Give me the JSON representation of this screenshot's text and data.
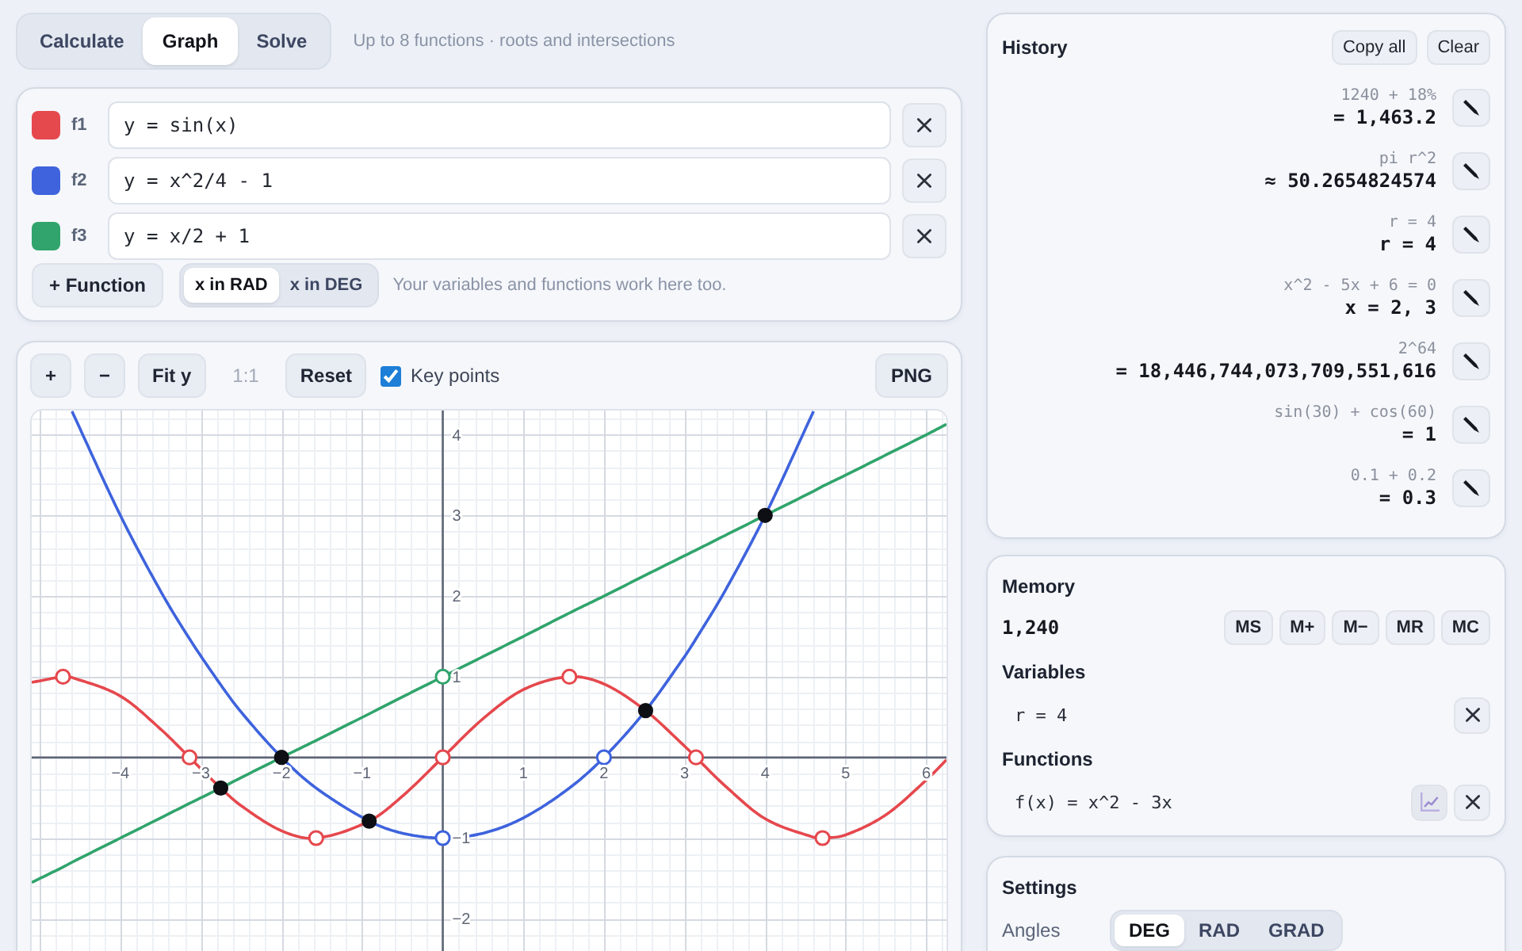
{
  "mode_tabs": [
    {
      "label": "Calculate",
      "selected": false
    },
    {
      "label": "Graph",
      "selected": true
    },
    {
      "label": "Solve",
      "selected": false
    }
  ],
  "mode_hint": "Up to 8 functions · roots and intersections",
  "functions": [
    {
      "label": "f1",
      "color": "#e5484d",
      "expression": "y = sin(x)"
    },
    {
      "label": "f2",
      "color": "#3e63dd",
      "expression": "y = x^2/4 - 1"
    },
    {
      "label": "f3",
      "color": "#30a46c",
      "expression": "y = x/2 + 1"
    }
  ],
  "function_bar": {
    "add_button": "+ Function",
    "x_units": [
      {
        "label": "x in RAD",
        "selected": true
      },
      {
        "label": "x in DEG",
        "selected": false
      }
    ],
    "hint": "Your variables and functions work here too."
  },
  "graph": {
    "toolbar": [
      {
        "label": "+",
        "disabled": false
      },
      {
        "label": "−",
        "disabled": false
      },
      {
        "label": "Fit y",
        "disabled": false
      },
      {
        "label": "1:1",
        "disabled": true
      },
      {
        "label": "Reset",
        "disabled": false
      }
    ],
    "key_points": {
      "label": "Key points",
      "checked": true
    },
    "export_button": "PNG",
    "chart_data": {
      "type": "line",
      "grid": true,
      "x": [
        -5.1,
        -4.712,
        -4.6,
        -4,
        -3.5,
        -3.142,
        -2.755,
        -2.5,
        -2,
        -1.571,
        -0.913,
        -0.5,
        0,
        0.5,
        1,
        1.571,
        2,
        2.517,
        3,
        3.142,
        3.5,
        4,
        4.6,
        4.712,
        5,
        5.5,
        6,
        6.25
      ],
      "series": [
        {
          "color": "#e5484d",
          "values": [
            0.93,
            1,
            0.99,
            0.76,
            0.35,
            0,
            -0.38,
            -0.6,
            -0.91,
            -1,
            -0.79,
            -0.48,
            0,
            0.48,
            0.84,
            1,
            0.91,
            0.58,
            0.14,
            0,
            -0.35,
            -0.76,
            -0.99,
            -1,
            -0.96,
            -0.71,
            -0.28,
            -0.03
          ]
        },
        {
          "color": "#3e63dd",
          "values": [
            null,
            null,
            4.29,
            3,
            2.06,
            1.47,
            0.9,
            0.56,
            0,
            -0.38,
            -0.79,
            -0.94,
            -1,
            -0.94,
            -0.75,
            -0.38,
            0,
            0.58,
            1.25,
            1.47,
            2.06,
            3,
            4.29,
            null,
            null,
            null,
            null,
            null
          ]
        },
        {
          "color": "#30a46c",
          "values": [
            -1.55,
            -1.36,
            -1.3,
            -1,
            -0.75,
            -0.57,
            -0.38,
            -0.25,
            0,
            0.21,
            0.54,
            0.75,
            1,
            1.25,
            1.5,
            1.79,
            2,
            2.26,
            2.5,
            2.57,
            2.75,
            3,
            3.3,
            3.36,
            3.5,
            3.75,
            4,
            4.13
          ]
        }
      ],
      "xlim": [
        -5.1,
        6.25
      ],
      "ylim": [
        -2.4,
        4.3
      ],
      "xticks": [
        {
          "value": -4,
          "label": "−4"
        },
        {
          "value": -3,
          "label": "−3"
        },
        {
          "value": -2,
          "label": "−2"
        },
        {
          "value": -1,
          "label": "−1"
        },
        1,
        2,
        3,
        4,
        5,
        6
      ],
      "yticks": [
        {
          "value": -2,
          "label": "−2"
        },
        {
          "value": -1,
          "label": "−1"
        },
        1,
        2,
        3,
        4
      ]
    }
  },
  "history": {
    "title": "History",
    "buttons": [
      "Copy all",
      "Clear"
    ],
    "entries": [
      {
        "expression": "1240 + 18%",
        "result": "= 1,463.2"
      },
      {
        "expression": "pi r^2",
        "result": "≈ 50.2654824574"
      },
      {
        "expression": "r = 4",
        "result": "r = 4"
      },
      {
        "expression": "x^2 - 5x + 6 = 0",
        "result": "x = 2, 3"
      },
      {
        "expression": "2^64",
        "result": "= 18,446,744,073,709,551,616"
      },
      {
        "expression": "sin(30) + cos(60)",
        "result": "= 1"
      },
      {
        "expression": "0.1 + 0.2",
        "result": "= 0.3"
      }
    ]
  },
  "memory": {
    "title": "Memory",
    "value": "1,240",
    "buttons": [
      "MS",
      "M+",
      "M−",
      "MR",
      "MC"
    ],
    "variables_title": "Variables",
    "variables": [
      "r = 4"
    ],
    "functions_title": "Functions",
    "functions": [
      "f(x) = x^2 - 3x"
    ]
  },
  "settings": {
    "title": "Settings",
    "angles": {
      "label": "Angles",
      "options": [
        {
          "label": "DEG",
          "selected": true
        },
        {
          "label": "RAD",
          "selected": false
        },
        {
          "label": "GRAD",
          "selected": false
        }
      ]
    }
  }
}
